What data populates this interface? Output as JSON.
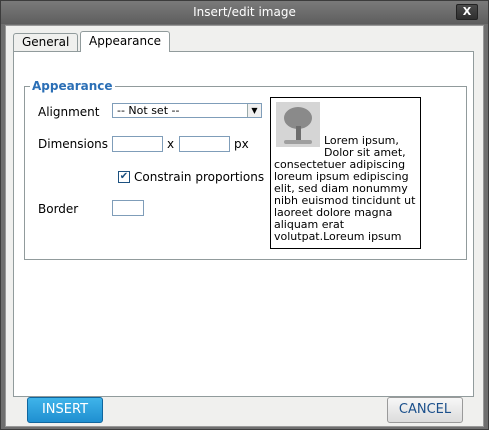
{
  "window": {
    "title": "Insert/edit image",
    "close_label": "X"
  },
  "tabs": [
    {
      "label": "General"
    },
    {
      "label": "Appearance"
    }
  ],
  "appearance": {
    "legend": "Appearance",
    "alignment_label": "Alignment",
    "alignment_value": "-- Not set --",
    "dimensions_label": "Dimensions",
    "dimensions_sep": "x",
    "dimensions_unit": "px",
    "width_value": "",
    "height_value": "",
    "constrain_label": "Constrain proportions",
    "constrain_checked": true,
    "border_label": "Border",
    "border_value": "",
    "preview_text": "Lorem ipsum, Dolor sit amet, consectetuer adipiscing loreum ipsum edipiscing elit, sed diam nonummy nibh euismod tincidunt ut laoreet dolore magna aliquam erat volutpat.Loreum ipsum"
  },
  "buttons": {
    "insert": "INSERT",
    "cancel": "CANCEL"
  }
}
